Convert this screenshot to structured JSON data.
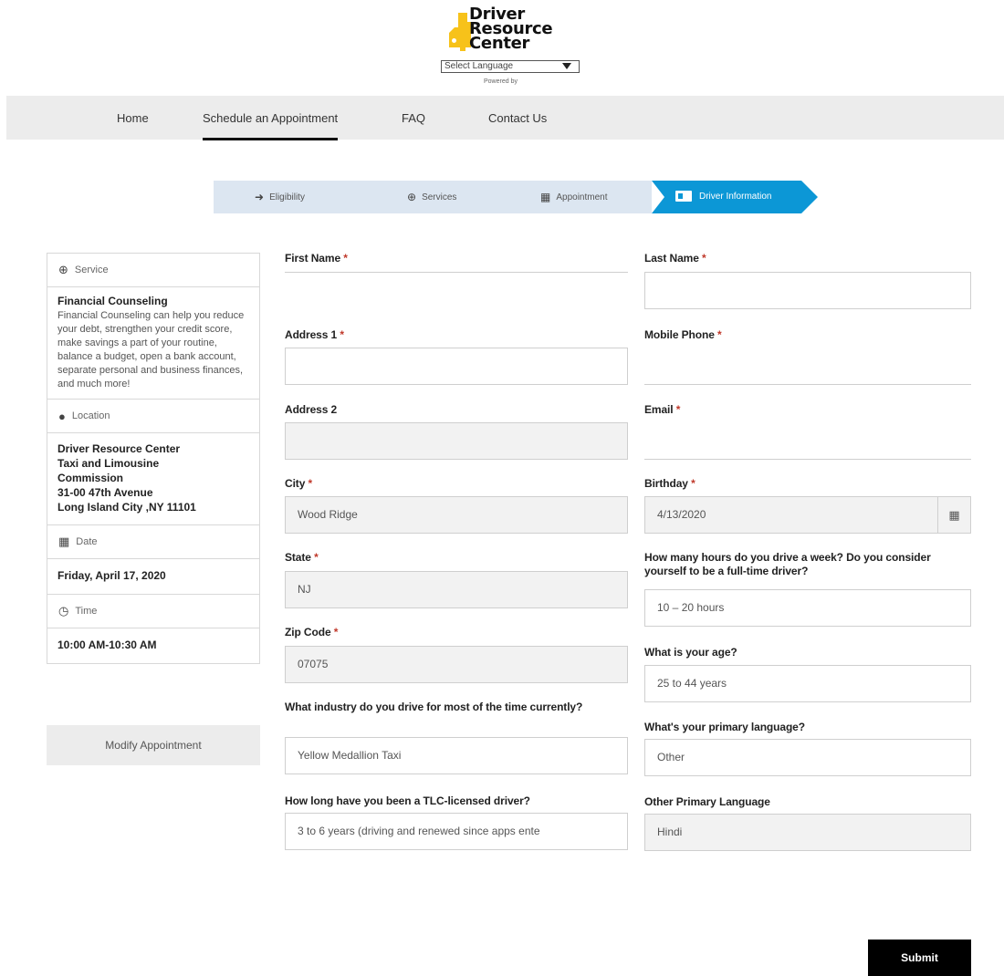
{
  "header": {
    "logo_line1": "Driver",
    "logo_line2": "Resource",
    "logo_line3": "Center",
    "language_select": "Select Language",
    "powered_by": "Powered by"
  },
  "nav": {
    "items": [
      "Home",
      "Schedule an Appointment",
      "FAQ",
      "Contact Us"
    ],
    "active": "Schedule an Appointment"
  },
  "stepper": {
    "steps": [
      "Eligibility",
      "Services",
      "Appointment",
      "Driver Information"
    ],
    "active": "Driver Information"
  },
  "summary": {
    "service_header": "Service",
    "service_title": "Financial Counseling",
    "service_desc": "Financial Counseling can help you reduce your debt, strengthen your credit score, make savings a part of your routine, balance a budget, open a bank account, separate personal and business finances, and much more!",
    "location_header": "Location",
    "location_lines": [
      "Driver Resource Center",
      "Taxi and Limousine",
      "Commission",
      "31-00 47th Avenue",
      "Long Island City ,NY 11101"
    ],
    "date_header": "Date",
    "date_value": "Friday, April 17, 2020",
    "time_header": "Time",
    "time_value": "10:00 AM-10:30 AM",
    "modify_label": "Modify Appointment"
  },
  "form": {
    "required_mark": "*",
    "first_name": {
      "label": "First Name",
      "value": ""
    },
    "last_name": {
      "label": "Last Name",
      "value": ""
    },
    "address1": {
      "label": "Address 1",
      "value": ""
    },
    "mobile_phone": {
      "label": "Mobile Phone",
      "value": ""
    },
    "address2": {
      "label": "Address 2",
      "value": ""
    },
    "email": {
      "label": "Email",
      "value": ""
    },
    "city": {
      "label": "City",
      "value": "Wood Ridge"
    },
    "birthday": {
      "label": "Birthday",
      "value": "4/13/2020"
    },
    "state": {
      "label": "State",
      "value": "NJ"
    },
    "hours": {
      "label": "How many hours do you drive a week? Do you consider yourself to be a full-time driver?",
      "value": "10 – 20 hours"
    },
    "zip": {
      "label": "Zip Code",
      "value": "07075"
    },
    "age": {
      "label": "What is your age?",
      "value": "25 to 44 years"
    },
    "industry": {
      "label": "What industry do you drive for most of the time currently?",
      "value": "Yellow Medallion Taxi"
    },
    "primary_language": {
      "label": "What's your primary language?",
      "value": "Other"
    },
    "tlc_duration": {
      "label": "How long have you been a TLC-licensed driver?",
      "value": "3 to 6 years (driving and renewed since apps ente"
    },
    "other_language": {
      "label": "Other Primary Language",
      "value": "Hindi"
    },
    "submit_label": "Submit"
  }
}
